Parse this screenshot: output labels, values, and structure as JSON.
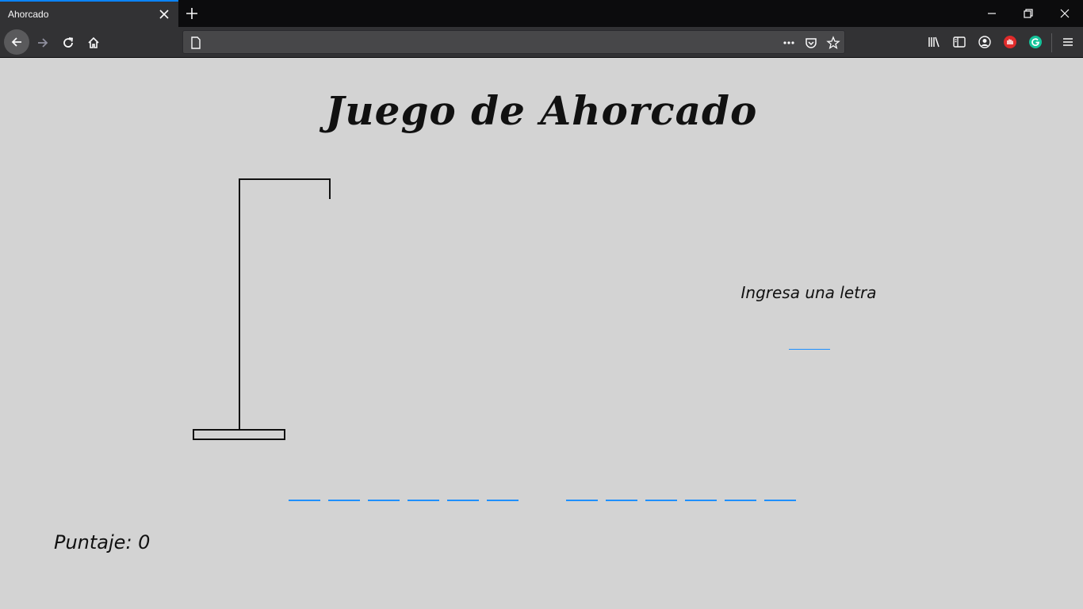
{
  "browser": {
    "tab_title": "Ahorcado",
    "url": ""
  },
  "game": {
    "title": "Juego de Ahorcado",
    "prompt": "Ingresa una letra",
    "letter_value": "",
    "word_groups": [
      6,
      6
    ],
    "revealed_letters": [
      "",
      "",
      "",
      "",
      "",
      "",
      "",
      "",
      "",
      "",
      "",
      ""
    ],
    "score_label": "Puntaje:",
    "score_value": "0"
  },
  "colors": {
    "page_bg": "#d3d3d3",
    "accent": "#1e90ff",
    "ink": "#111111"
  }
}
